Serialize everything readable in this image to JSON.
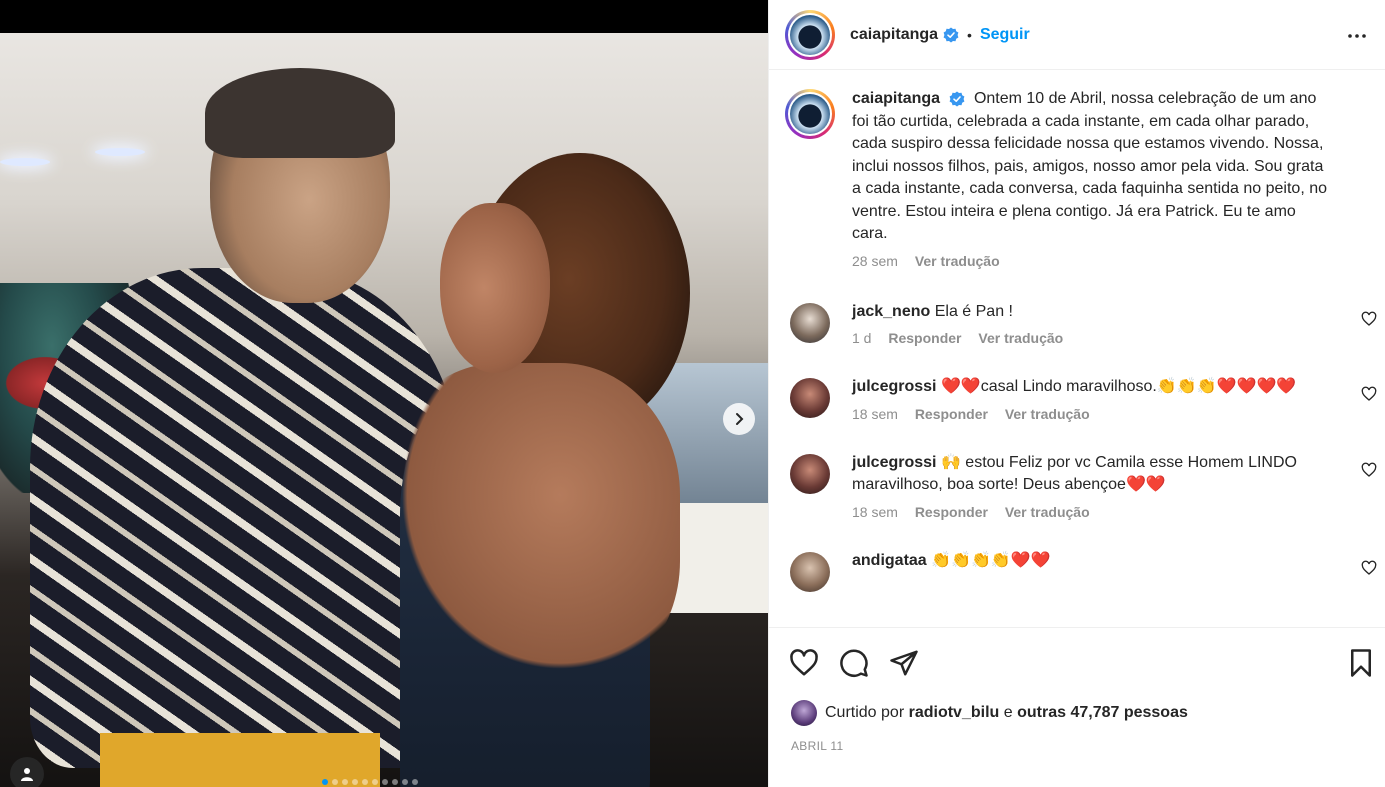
{
  "media": {
    "carousel_index": 1,
    "carousel_total": 10
  },
  "post": {
    "author": "caiapitanga",
    "follow_label": "Seguir",
    "separator": "•",
    "caption": "Ontem 10 de Abril, nossa celebração de um ano foi tão curtida, celebrada a cada instante, em cada olhar parado, cada suspiro dessa felicidade nossa que estamos vivendo. Nossa, inclui nossos filhos, pais, amigos, nosso amor pela vida. Sou grata a cada instante, cada conversa, cada faquinha sentida no peito, no ventre. Estou inteira e plena contigo. Já era Patrick. Eu te amo cara.",
    "caption_time": "28 sem",
    "caption_translate": "Ver tradução"
  },
  "comments": [
    {
      "user": "jack_neno",
      "text": "Ela é Pan !",
      "time": "1 d",
      "reply": "Responder",
      "translate": "Ver tradução"
    },
    {
      "user": "julcegrossi",
      "text": "❤️❤️casal Lindo maravilhoso.👏👏👏❤️❤️❤️❤️",
      "time": "18 sem",
      "reply": "Responder",
      "translate": "Ver tradução"
    },
    {
      "user": "julcegrossi",
      "text": "🙌 estou Feliz por vc Camila esse Homem LINDO maravilhoso, boa sorte! Deus abençoe❤️❤️",
      "time": "18 sem",
      "reply": "Responder",
      "translate": "Ver tradução"
    },
    {
      "user": "andigataa",
      "text": "👏👏👏👏❤️❤️"
    }
  ],
  "likes": {
    "prefix": "Curtido por",
    "user": "radiotv_bilu",
    "conj": "e",
    "others": "outras 47,787 pessoas"
  },
  "date": "ABRIL 11",
  "colors": {
    "accent": "#0095f6",
    "text": "#262626",
    "muted": "#8e8e8e"
  }
}
